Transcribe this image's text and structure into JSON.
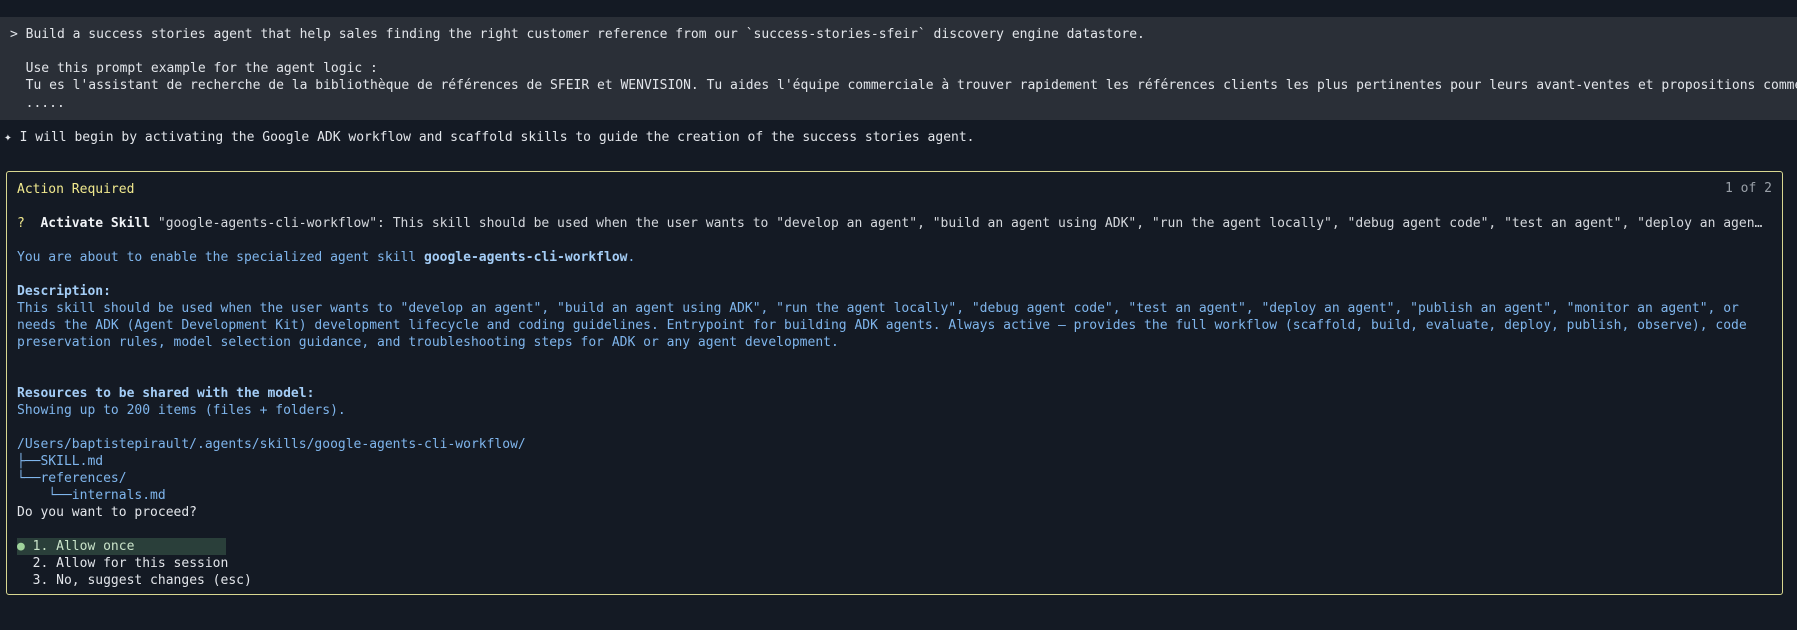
{
  "prompt": {
    "line1": "> Build a success stories agent that help sales finding the right customer reference from our `success-stories-sfeir` discovery engine datastore.",
    "line2": "  Use this prompt example for the agent logic :",
    "line3": "  Tu es l'assistant de recherche de la bibliothèque de références de SFEIR et WENVISION. Tu aides l'équipe commerciale à trouver rapidement les références clients les plus pertinentes pour leurs avant-ventes et propositions commerciales.",
    "line4": "  ....."
  },
  "agent_message": "✦ I will begin by activating the Google ADK workflow and scaffold skills to guide the creation of the success stories agent.",
  "action": {
    "title": "Action Required",
    "counter": "1 of 2",
    "question_mark": "?",
    "ask_bold": "Activate Skill",
    "ask_text": " \"google-agents-cli-workflow\": This skill should be used when the user wants to \"develop an agent\", \"build an agent using ADK\", \"run the agent locally\", \"debug agent code\", \"test an agent\", \"deploy an agent\", \"publish an agent\", \"monitor an agent\", or needs the ADK",
    "enable_prefix": "You are about to enable the specialized agent skill ",
    "enable_skill": "google-agents-cli-workflow",
    "enable_suffix": ".",
    "desc_label": "Description:",
    "desc_text": "This skill should be used when the user wants to \"develop an agent\", \"build an agent using ADK\", \"run the agent locally\", \"debug agent code\", \"test an agent\", \"deploy an agent\", \"publish an agent\", \"monitor an agent\", or needs the ADK (Agent Development Kit) development lifecycle and coding guidelines. Entrypoint for building ADK agents. Always active — provides the full workflow (scaffold, build, evaluate, deploy, publish, observe), code preservation rules, model selection guidance, and troubleshooting steps for ADK or any agent development.",
    "resources_label": "Resources to be shared with the model:",
    "resources_note": "Showing up to 200 items (files + folders).",
    "root_path": "/Users/baptistepirault/.agents/skills/google-agents-cli-workflow/",
    "tree": [
      "├──SKILL.md",
      "└──references/",
      "    └──internals.md"
    ],
    "proceed_question": "Do you want to proceed?",
    "options": [
      {
        "marker": "●",
        "label": "1. Allow once"
      },
      {
        "marker": " ",
        "label": "2. Allow for this session"
      },
      {
        "marker": " ",
        "label": "3. No, suggest changes (esc)"
      }
    ]
  }
}
